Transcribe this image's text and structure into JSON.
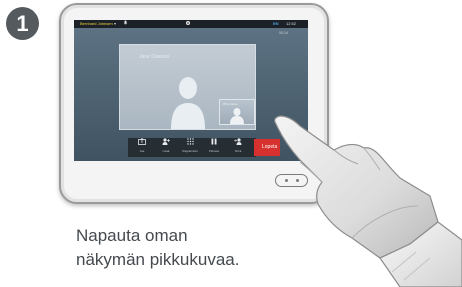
{
  "step": {
    "number": "1"
  },
  "status_bar": {
    "user_name": "Bernhard Johnsen",
    "user_chevron": "▾",
    "microphone_icon": "mic-icon",
    "camera_icon": "camera-icon",
    "language": "EN",
    "clock": "12:52"
  },
  "call": {
    "duration": "00:14",
    "remote_participant": "Jane Dawson",
    "self_view_label": "Who Alone"
  },
  "pages": {
    "count": 2,
    "active": 1
  },
  "toolbar": {
    "items": [
      {
        "icon": "share-icon",
        "label": "Jaa"
      },
      {
        "icon": "add-contact-icon",
        "label": "Lisää"
      },
      {
        "icon": "keypad-icon",
        "label": "Näppäimistö"
      },
      {
        "icon": "pause-icon",
        "label": "Pidossa"
      },
      {
        "icon": "transfer-icon",
        "label": "Siirrä"
      }
    ],
    "end_label": "Lopeta"
  },
  "caption": {
    "line1": "Napauta oman",
    "line2": "näkymän pikkukuvaa."
  },
  "colors": {
    "badge": "#555a5e",
    "screen": "#4f6373",
    "end_call": "#d6302f",
    "accent_user": "#f0d23c",
    "caption_text": "#444a4f"
  }
}
